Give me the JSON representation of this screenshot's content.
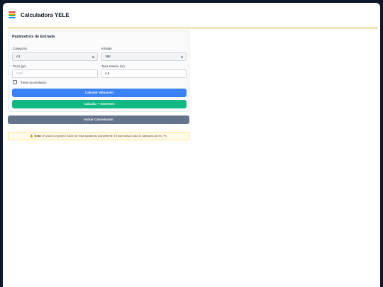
{
  "app": {
    "title": "Calculadora YELE"
  },
  "form": {
    "section_title": "Parámetros de Entrada",
    "categoria": {
      "label": "Categoría",
      "value": "A1"
    },
    "kilataje": {
      "label": "Kilataje",
      "value": "18K"
    },
    "peso": {
      "label": "Peso (gr)",
      "placeholder": "0.00"
    },
    "tasa": {
      "label": "Tasa Interés (%)",
      "value": "4.6"
    },
    "acumulados": {
      "label": "Tiene acumulados",
      "checked": false
    },
    "btn_valuacion": "Calcular Valuación",
    "btn_intereses": "Calcular + Intereses"
  },
  "btn_cancelacion": "Incluir Cancelación",
  "alert": {
    "icon": "warning-icon",
    "strong": "Nota:",
    "text": " El valor por gramo (VAG) se está ajustando diariamente. El tope actual para la categoría A5 es 7%."
  },
  "colors": {
    "blue": "#3b82f6",
    "green": "#10b981",
    "slate": "#64748b",
    "gold": "#d4a72c"
  }
}
